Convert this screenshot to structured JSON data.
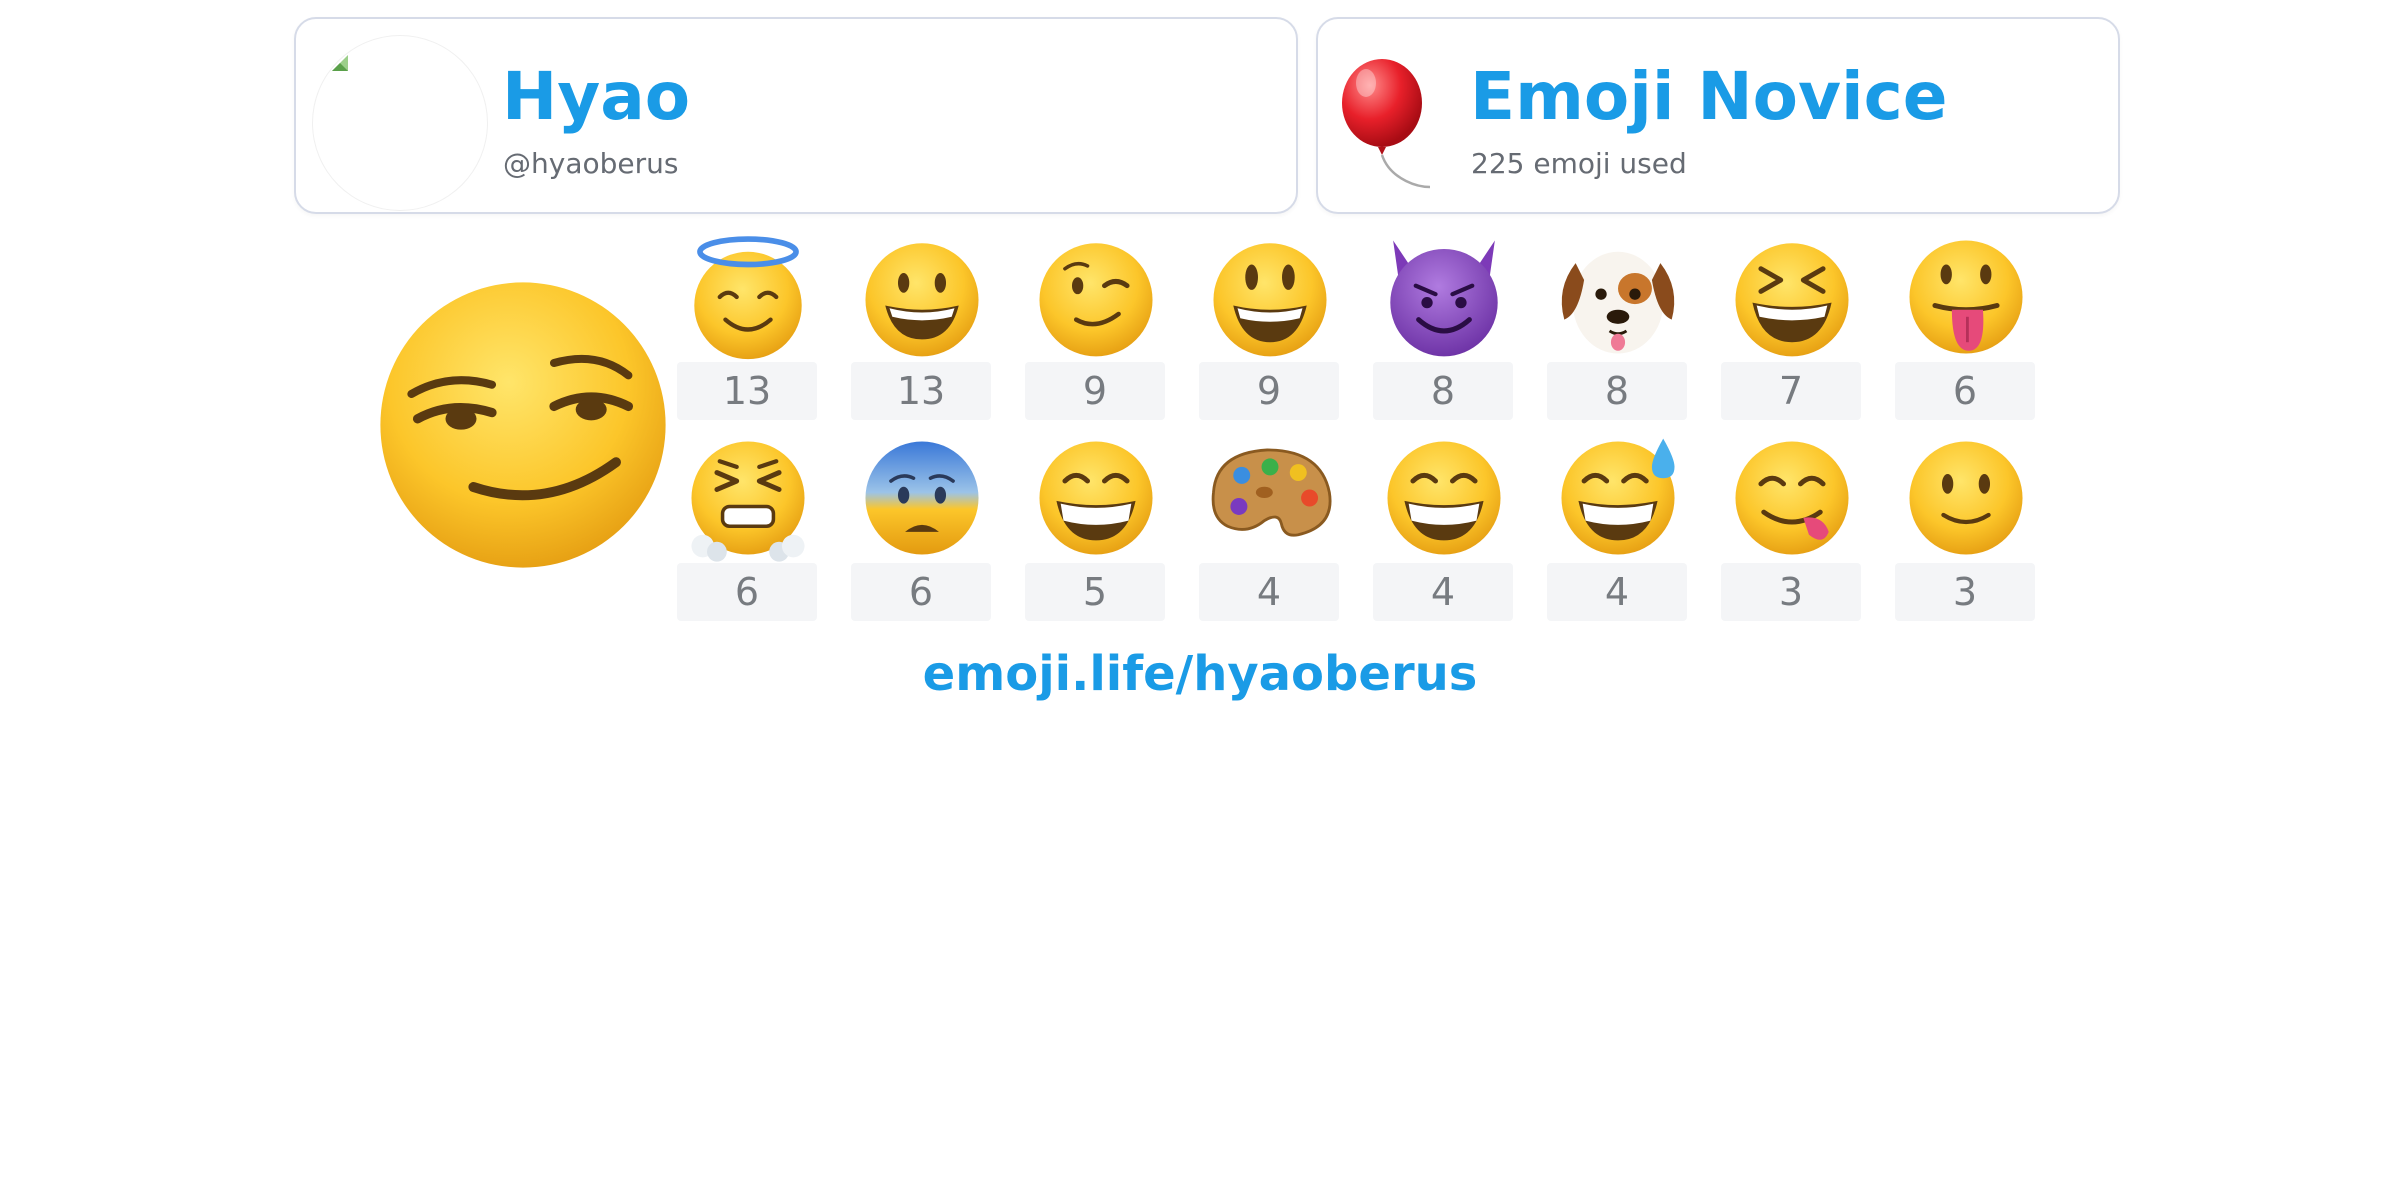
{
  "profile": {
    "name": "Hyao",
    "handle": "@hyaoberus"
  },
  "level": {
    "title": "Emoji Novice",
    "used": "225 emoji used",
    "icon": "balloon-icon"
  },
  "top_emoji": {
    "icon": "smirking-face-emoji"
  },
  "emoji_stats": [
    {
      "icon": "smiling-face-with-halo-emoji",
      "count": "13"
    },
    {
      "icon": "grinning-face-emoji",
      "count": "13"
    },
    {
      "icon": "winking-face-emoji",
      "count": "9"
    },
    {
      "icon": "grinning-face-with-big-eyes-emoji",
      "count": "9"
    },
    {
      "icon": "smiling-face-with-horns-emoji",
      "count": "8"
    },
    {
      "icon": "dog-face-emoji",
      "count": "8"
    },
    {
      "icon": "grinning-squinting-face-emoji",
      "count": "7"
    },
    {
      "icon": "face-with-tongue-emoji",
      "count": "6"
    },
    {
      "icon": "face-with-steam-from-nose-emoji",
      "count": "6"
    },
    {
      "icon": "anxious-face-emoji",
      "count": "6"
    },
    {
      "icon": "beaming-face-emoji",
      "count": "5"
    },
    {
      "icon": "artist-palette-emoji",
      "count": "4"
    },
    {
      "icon": "beaming-face-emoji",
      "count": "4"
    },
    {
      "icon": "grinning-face-with-sweat-emoji",
      "count": "4"
    },
    {
      "icon": "face-savoring-food-emoji",
      "count": "3"
    },
    {
      "icon": "slightly-smiling-face-emoji",
      "count": "3"
    }
  ],
  "footer": {
    "link": "emoji.life/hyaoberus"
  },
  "colors": {
    "accent": "#1a9be6",
    "card_border": "#d6dbe8",
    "count_bg": "#f4f5f7",
    "count_text": "#777b80"
  }
}
